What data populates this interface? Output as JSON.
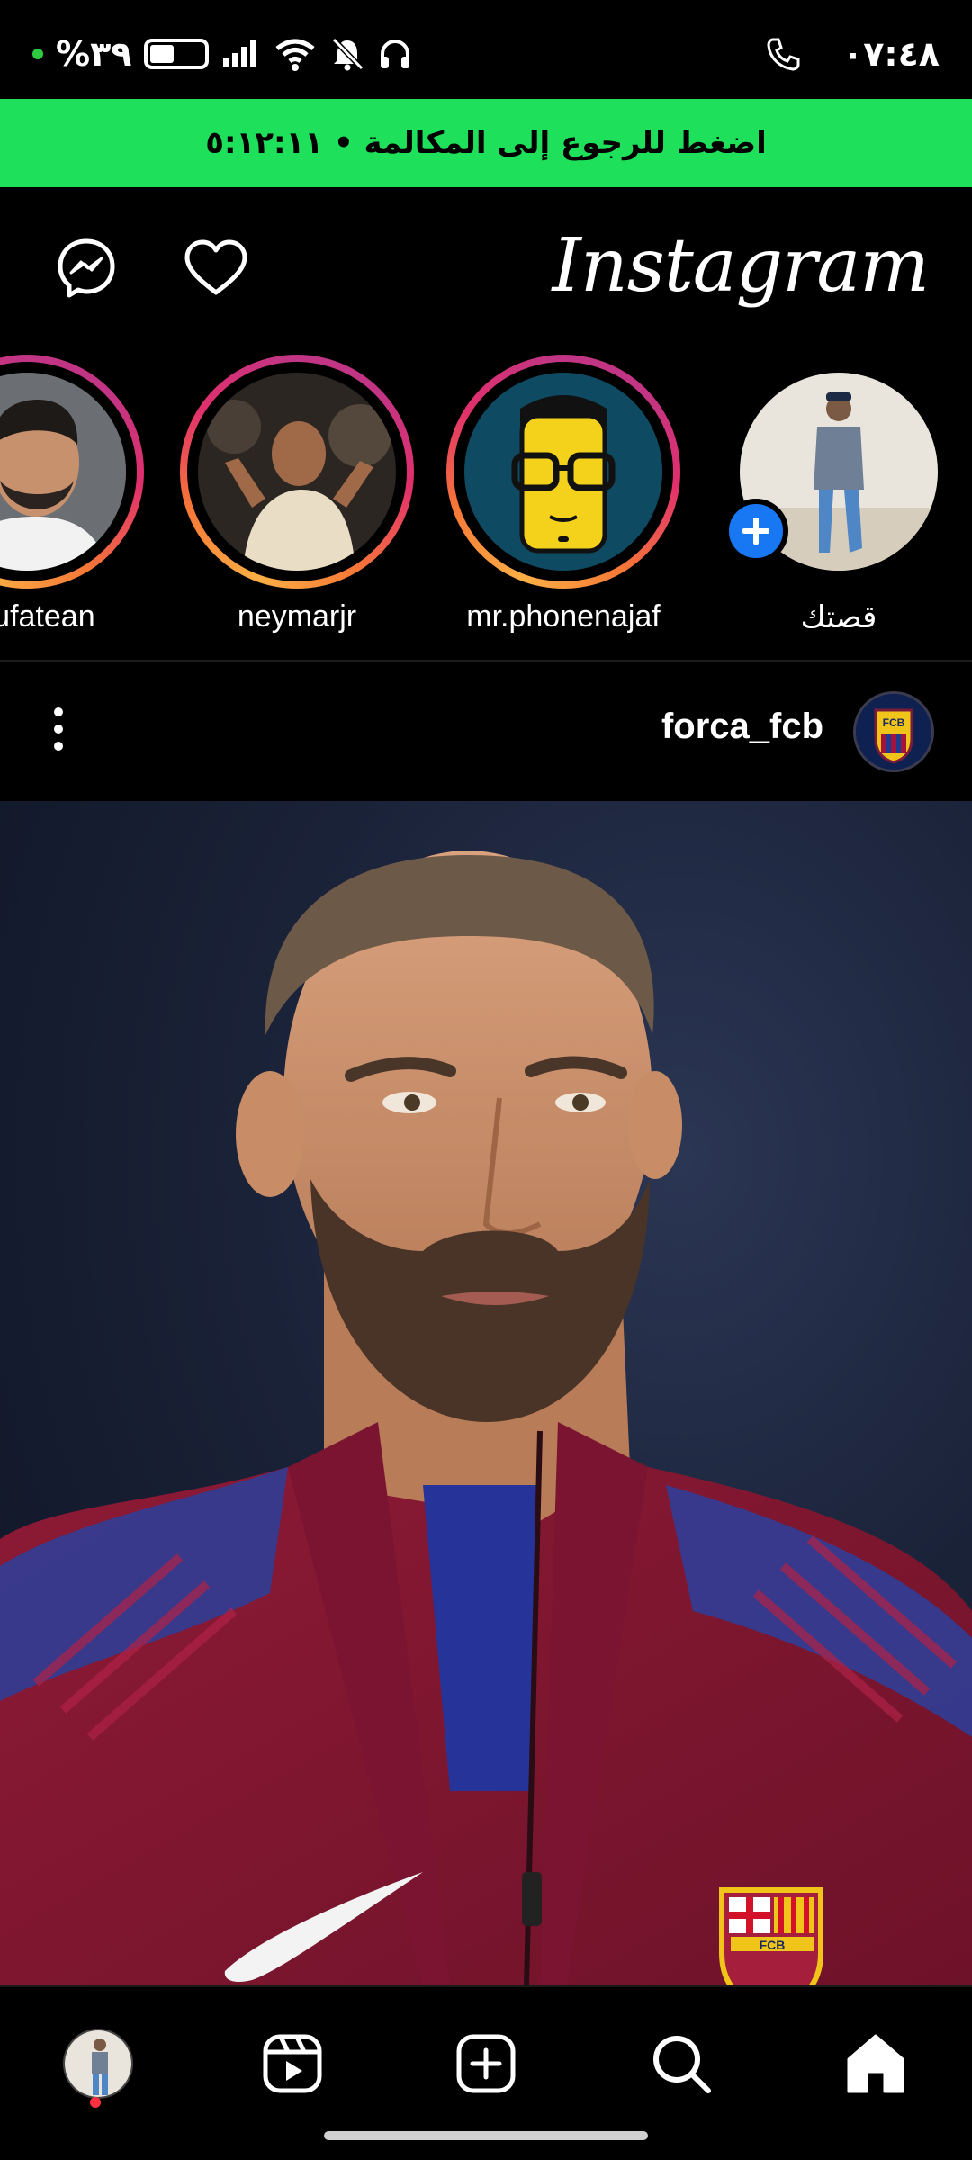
{
  "status_bar": {
    "battery_text": "%٣٩",
    "time": "٠٧:٤٨",
    "icons": [
      "dot-indicator-icon",
      "battery-icon",
      "signal-icon",
      "wifi-icon",
      "bell-muted-icon",
      "headphones-icon",
      "phone-call-icon"
    ],
    "battery_level": 0.39
  },
  "call_banner": {
    "text": "اضغط للرجوع إلى المكالمة • ٥:١٢:١١",
    "color": "#1ee05b"
  },
  "header": {
    "logo": "Instagram",
    "icons": [
      "messenger-icon",
      "heart-icon"
    ]
  },
  "stories": [
    {
      "label": "abufatean",
      "ring": true
    },
    {
      "label": "neymarjr",
      "ring": true
    },
    {
      "label": "mr.phonenajaf",
      "ring": true
    },
    {
      "label": "قصتك",
      "ring": false,
      "add_badge": true
    }
  ],
  "post": {
    "username": "forca_fcb",
    "avatar_text": "FCB",
    "crest_text": "FCB"
  },
  "bottom_nav": {
    "items": [
      "profile-avatar",
      "reels-icon",
      "create-icon",
      "search-icon",
      "home-icon"
    ],
    "active": "home-icon"
  },
  "colors": {
    "background": "#000000",
    "story_ring": [
      "#fcaf45",
      "#f77737",
      "#e1306c",
      "#c13584"
    ],
    "add_badge": "#1877f2",
    "notification_dot": "#ff3040"
  }
}
